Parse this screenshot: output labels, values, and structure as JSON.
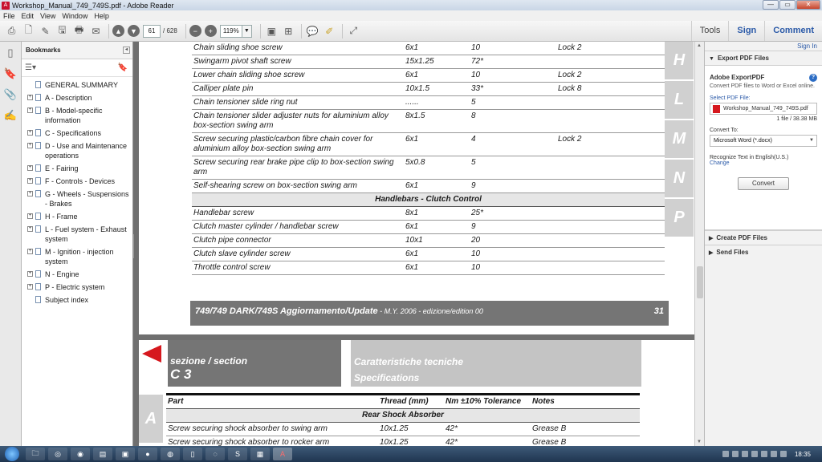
{
  "window": {
    "title": "Workshop_Manual_749_749S.pdf - Adobe Reader",
    "controls": [
      "—",
      "▭",
      "✕"
    ]
  },
  "menu": [
    "File",
    "Edit",
    "View",
    "Window",
    "Help"
  ],
  "toolbar": {
    "page_current": "61",
    "page_total": "/ 628",
    "zoom": "119%",
    "tools_label": "Tools",
    "sign_label": "Sign",
    "comment_label": "Comment"
  },
  "bookmarks": {
    "title": "Bookmarks",
    "items": [
      {
        "label": "GENERAL SUMMARY",
        "expandable": false
      },
      {
        "label": "A - Description",
        "expandable": true
      },
      {
        "label": "B - Model-specific information",
        "expandable": true
      },
      {
        "label": "C - Specifications",
        "expandable": true
      },
      {
        "label": "D - Use and Maintenance operations",
        "expandable": true
      },
      {
        "label": "E - Fairing",
        "expandable": true
      },
      {
        "label": "F - Controls - Devices",
        "expandable": true
      },
      {
        "label": "G - Wheels - Suspensions - Brakes",
        "expandable": true
      },
      {
        "label": "H - Frame",
        "expandable": true
      },
      {
        "label": "L - Fuel system - Exhaust system",
        "expandable": true
      },
      {
        "label": "M - Ignition - injection system",
        "expandable": true
      },
      {
        "label": "N - Engine",
        "expandable": true
      },
      {
        "label": "P - Electric system",
        "expandable": true
      },
      {
        "label": "Subject index",
        "expandable": false
      }
    ]
  },
  "page1": {
    "rows": [
      {
        "part": "Chain sliding shoe screw",
        "thread": "6x1",
        "nm": "10",
        "notes": "Lock 2"
      },
      {
        "part": "Swingarm pivot shaft screw",
        "thread": "15x1.25",
        "nm": "72*",
        "notes": ""
      },
      {
        "part": "Lower chain sliding shoe screw",
        "thread": "6x1",
        "nm": "10",
        "notes": "Lock 2"
      },
      {
        "part": "Calliper plate pin",
        "thread": "10x1.5",
        "nm": "33*",
        "notes": "Lock 8"
      },
      {
        "part": "Chain tensioner slide ring nut",
        "thread": "......",
        "nm": "5",
        "notes": ""
      },
      {
        "part": "Chain tensioner slider adjuster nuts for aluminium alloy box-section swing arm",
        "thread": "8x1.5",
        "nm": "8",
        "notes": ""
      },
      {
        "part": "Screw securing plastic/carbon fibre chain cover for aluminium alloy box-section swing arm",
        "thread": "6x1",
        "nm": "4",
        "notes": "Lock 2"
      },
      {
        "part": "Screw securing rear brake pipe clip to box-section swing arm",
        "thread": "5x0.8",
        "nm": "5",
        "notes": ""
      },
      {
        "part": "Self-shearing screw on box-section swing arm",
        "thread": "6x1",
        "nm": "9",
        "notes": ""
      }
    ],
    "section_title": "Handlebars - Clutch Control",
    "rows2": [
      {
        "part": "Handlebar screw",
        "thread": "8x1",
        "nm": "25*",
        "notes": ""
      },
      {
        "part": "Clutch master cylinder / handlebar screw",
        "thread": "6x1",
        "nm": "9",
        "notes": ""
      },
      {
        "part": "Clutch pipe connector",
        "thread": "10x1",
        "nm": "20",
        "notes": ""
      },
      {
        "part": "Clutch slave cylinder screw",
        "thread": "6x1",
        "nm": "10",
        "notes": ""
      },
      {
        "part": "Throttle control screw",
        "thread": "6x1",
        "nm": "10",
        "notes": ""
      }
    ],
    "side_tabs": [
      "H",
      "L",
      "M",
      "N",
      "P"
    ],
    "footer_title": "749/749 DARK/749S Aggiornamento/Update",
    "footer_sub": " - M.Y. 2006 - edizione/edition 00",
    "footer_page": "31"
  },
  "page2": {
    "section_label": "sezione / section",
    "section_code": "C 3",
    "spec_it": "Caratteristiche tecniche",
    "spec_en": "Specifications",
    "side_tab": "A",
    "headers": {
      "part": "Part",
      "thread": "Thread (mm)",
      "nm": "Nm ±10% Tolerance",
      "notes": "Notes"
    },
    "section_title": "Rear Shock Absorber",
    "rows": [
      {
        "part": "Screw securing shock absorber to swing arm",
        "thread": "10x1.25",
        "nm": "42*",
        "notes": "Grease B"
      },
      {
        "part": "Screw securing shock absorber to rocker arm",
        "thread": "10x1.25",
        "nm": "42*",
        "notes": "Grease B"
      }
    ]
  },
  "tools_pane": {
    "sign_in": "Sign In",
    "export_header": "Export PDF Files",
    "service_name": "Adobe ExportPDF",
    "service_desc": "Convert PDF files to Word or Excel online.",
    "select_label": "Select PDF File:",
    "file_name": "Workshop_Manual_749_749S.pdf",
    "file_meta": "1 file / 38.38 MB",
    "convert_to_label": "Convert To:",
    "convert_option": "Microsoft Word (*.docx)",
    "recognize": "Recognize Text in English(U.S.)",
    "change": "Change",
    "convert_button": "Convert",
    "create_header": "Create PDF Files",
    "send_header": "Send Files"
  },
  "taskbar": {
    "clock": "18:35"
  }
}
